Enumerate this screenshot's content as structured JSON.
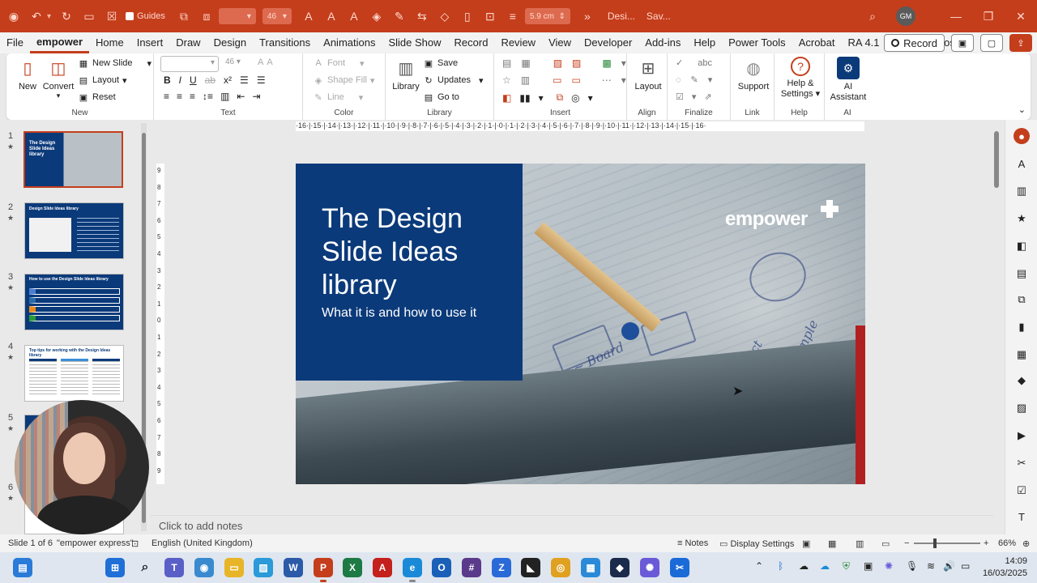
{
  "titlebar": {
    "guides_label": "Guides",
    "size_value": "5.9 cm",
    "font_size": "46",
    "doc_title": "Desi...",
    "save_status": "Sav...",
    "user_initials": "GM"
  },
  "tabs": [
    "File",
    "empower",
    "Home",
    "Insert",
    "Draw",
    "Design",
    "Transitions",
    "Animations",
    "Slide Show",
    "Record",
    "Review",
    "View",
    "Developer",
    "Add-ins",
    "Help",
    "Power Tools",
    "Acrobat",
    "RA 4.1",
    "Rede Macros"
  ],
  "active_tab": "empower",
  "record_label": "Record",
  "ribbon": {
    "new": {
      "new_label": "New",
      "convert_label": "Convert",
      "new_slide": "New Slide",
      "layout": "Layout",
      "reset": "Reset",
      "group": "New"
    },
    "text": {
      "group": "Text",
      "font_size": "46"
    },
    "color": {
      "font": "Font",
      "shape_fill": "Shape Fill",
      "line": "Line",
      "group": "Color"
    },
    "library": {
      "library_label": "Library",
      "save": "Save",
      "updates": "Updates",
      "goto": "Go to",
      "group": "Library"
    },
    "insert": {
      "group": "Insert"
    },
    "align": {
      "layout": "Layout",
      "group": "Align"
    },
    "finalize": {
      "group": "Finalize"
    },
    "link": {
      "support": "Support",
      "group": "Link"
    },
    "help": {
      "help_settings_1": "Help &",
      "help_settings_2": "Settings",
      "group": "Help"
    },
    "ai": {
      "label1": "AI",
      "label2": "Assistant",
      "group": "AI"
    }
  },
  "thumbnails": [
    {
      "num": "1",
      "title": "The Design Slide Ideas library"
    },
    {
      "num": "2",
      "title": "Design Slide Ideas library"
    },
    {
      "num": "3",
      "title": "How to use the Design Slide Ideas library"
    },
    {
      "num": "4",
      "title": "Top tips for working with the Design Ideas library"
    },
    {
      "num": "5",
      "title": ""
    },
    {
      "num": "6",
      "title": ""
    }
  ],
  "ruler_h": "·16·|·15·|·14·|·13·|·12·|·11·|·10·|·9·|·8·|·7·|·6·|·5·|·4·|·3·|·2·|·1·|·0·|·1·|·2·|·3·|·4·|·5·|·6·|·7·|·8·|·9·|·10·|·11·|·12·|·13·|·14·|·15·|·16·",
  "slide": {
    "title": "The Design Slide Ideas library",
    "subtitle": "What it is and how to use it",
    "logo": "empower"
  },
  "notes_placeholder": "Click to add notes",
  "status": {
    "slide_of": "Slide 1 of 6",
    "theme": "\"empower express\"",
    "language": "English (United Kingdom)",
    "notes": "Notes",
    "display_settings": "Display Settings",
    "zoom": "66%"
  },
  "clock": {
    "time": "14:09",
    "date": "16/03/2025"
  }
}
